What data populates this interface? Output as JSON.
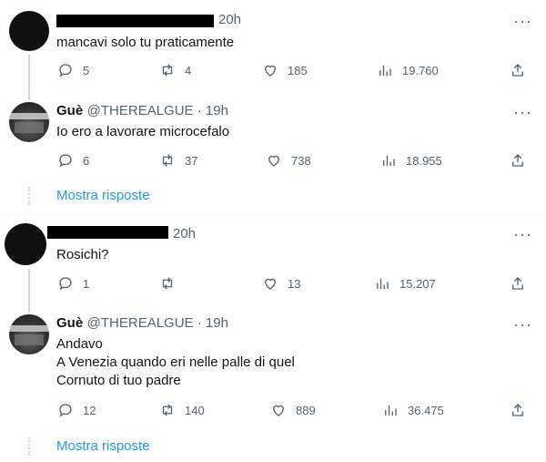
{
  "tweets": [
    {
      "time": "20h",
      "text": "mancavi solo tu praticamente",
      "replies": "5",
      "retweets": "4",
      "likes": "185",
      "views": "19.760"
    },
    {
      "name": "Guè",
      "handle_time": "@THEREALGUE · 19h",
      "text": "Io ero a lavorare microcefalo",
      "replies": "6",
      "retweets": "37",
      "likes": "738",
      "views": "18.955"
    },
    {
      "time": "20h",
      "text": "Rosichi?",
      "replies": "1",
      "retweets": "",
      "likes": "13",
      "views": "15.207"
    },
    {
      "name": "Guè",
      "handle_time": "@THEREALGUE · 19h",
      "text": "Andavo\nA Venezia quando eri nelle palle di quel\nCornuto di tuo padre",
      "replies": "12",
      "retweets": "140",
      "likes": "889",
      "views": "36.475"
    }
  ],
  "show_replies_label": "Mostra risposte",
  "more_label": "···",
  "colors": {
    "link": "#1d9bf0",
    "muted": "#536471",
    "text": "#0f1419"
  }
}
